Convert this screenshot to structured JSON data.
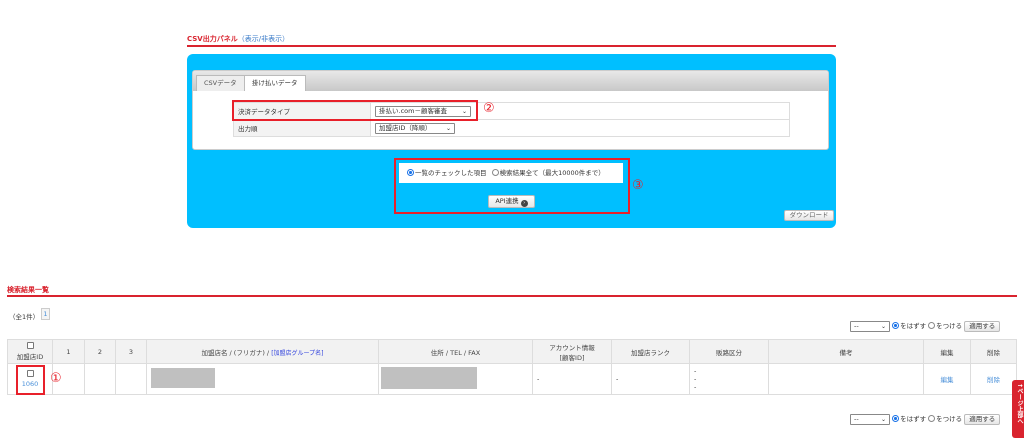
{
  "csv_panel": {
    "title": "CSV出力パネル",
    "toggle": "（表示/非表示）",
    "tabs": [
      {
        "label": "CSVデータ",
        "active": false
      },
      {
        "label": "掛け払いデータ",
        "active": true
      }
    ],
    "fields": [
      {
        "label": "決済データタイプ",
        "value": "掛払い.com－顧客審査"
      },
      {
        "label": "出力順",
        "value": "加盟店ID（降順）"
      }
    ],
    "radio_checked": "一覧のチェックした項目",
    "radio_all": "検索結果全て（最大10000件まで）",
    "api_button": "API連携",
    "download_button": "ダウンロード"
  },
  "annotations": {
    "one": "①",
    "two": "②",
    "three": "③"
  },
  "results": {
    "title": "検索結果一覧",
    "count": "（全1件）",
    "page": "1",
    "bulk": {
      "select": "--",
      "remove": "をはずす",
      "add": "をつける",
      "apply": "適用する"
    },
    "headers": {
      "id": "加盟店ID",
      "c1": "1",
      "c2": "2",
      "c3": "3",
      "name": "加盟店名 / (フリガナ) / ",
      "group": "[加盟店グループ名]",
      "addr": "住所 / TEL / FAX",
      "account": "アカウント情報",
      "account2": "[顧客ID]",
      "rank": "加盟店ランク",
      "channel": "販路区分",
      "note": "備考",
      "edit": "編集",
      "delete": "削除"
    },
    "rows": [
      {
        "id": "1060",
        "account": "-",
        "rank": "-",
        "channel": [
          "-",
          "-",
          "-"
        ],
        "edit": "編集",
        "delete": "削除"
      }
    ]
  },
  "page_top": "↑ページ上部へ",
  "colors": {
    "accent_red": "#d9232e",
    "panel_blue": "#00bfff",
    "link": "#4a90d9"
  }
}
